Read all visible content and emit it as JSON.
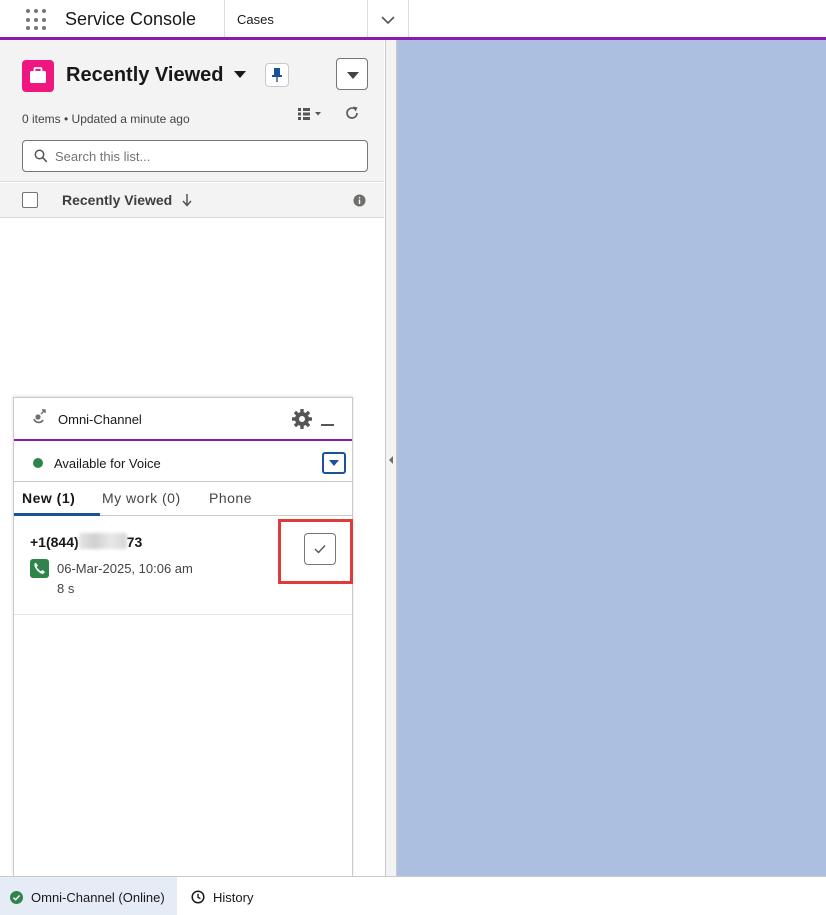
{
  "header": {
    "app_name": "Service Console",
    "nav_tab": "Cases",
    "icons": {
      "launcher": "app-launcher-icon",
      "nav_menu": "chevron-down-icon"
    }
  },
  "list_view": {
    "title": "Recently Viewed",
    "meta": "0 items • Updated a minute ago",
    "search_placeholder": "Search this list...",
    "column_header": "Recently Viewed",
    "icon_color": "#f0167f",
    "icons": [
      "briefcase-icon",
      "pin-icon",
      "list-view-menu-icon",
      "table-view-icon",
      "refresh-icon",
      "search-icon",
      "arrow-down-icon",
      "info-icon"
    ]
  },
  "omni_channel": {
    "title": "Omni-Channel",
    "status": "Available for Voice",
    "status_color": "#2e844a",
    "tabs": [
      {
        "label": "New (1)",
        "active": true
      },
      {
        "label": "My work (0)",
        "active": false
      },
      {
        "label": "Phone",
        "active": false
      }
    ],
    "work_item": {
      "caller_prefix": "+1(844)",
      "caller_suffix": "73",
      "timestamp": "06-Mar-2025, 10:06 am",
      "duration": "8 s"
    },
    "accent_color": "#8a1bb0"
  },
  "utility_bar": {
    "omni_label": "Omni-Channel (Online)",
    "history_label": "History"
  },
  "workspace_color": "#adbfe0"
}
